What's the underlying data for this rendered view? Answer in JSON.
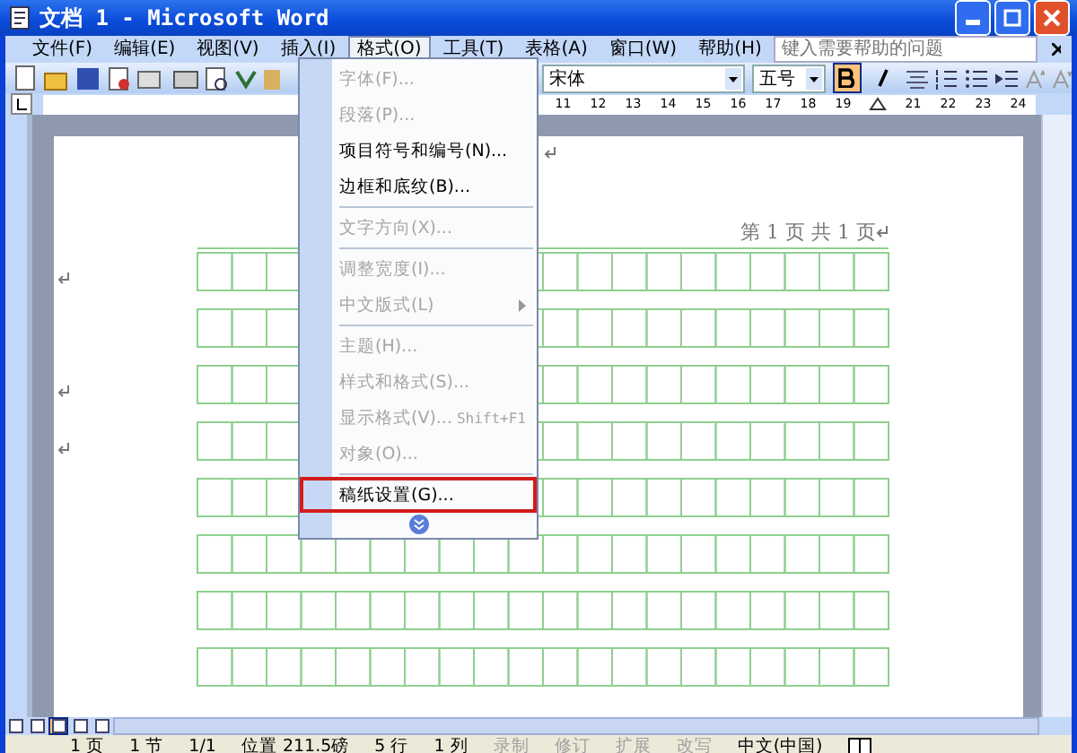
{
  "window": {
    "title": "文档 1 - Microsoft Word"
  },
  "menu_bar": [
    {
      "label": "文件(F)",
      "selected": false
    },
    {
      "label": "编辑(E)",
      "selected": false
    },
    {
      "label": "视图(V)",
      "selected": false
    },
    {
      "label": "插入(I)",
      "selected": false
    },
    {
      "label": "格式(O)",
      "selected": true
    },
    {
      "label": "工具(T)",
      "selected": false
    },
    {
      "label": "表格(A)",
      "selected": false
    },
    {
      "label": "窗口(W)",
      "selected": false
    },
    {
      "label": "帮助(H)",
      "selected": false
    }
  ],
  "help_search": {
    "placeholder": "键入需要帮助的问题"
  },
  "toolbar": {
    "font": "宋体",
    "size": "五号",
    "bold": true,
    "italic": false
  },
  "ruler": {
    "numbers": [
      "11",
      "12",
      "13",
      "14",
      "15",
      "16",
      "17",
      "18",
      "19",
      "21",
      "22",
      "23",
      "24"
    ]
  },
  "document": {
    "header": "第 1 页 共 1 页"
  },
  "format_menu": {
    "groups": [
      [
        {
          "label": "字体(F)...",
          "disabled": true,
          "highlighted": false
        },
        {
          "label": "段落(P)...",
          "disabled": true,
          "highlighted": false
        },
        {
          "label": "项目符号和编号(N)...",
          "disabled": false,
          "highlighted": false
        },
        {
          "label": "边框和底纹(B)...",
          "disabled": false,
          "highlighted": false
        }
      ],
      [
        {
          "label": "文字方向(X)...",
          "disabled": true,
          "highlighted": false
        }
      ],
      [
        {
          "label": "调整宽度(I)...",
          "disabled": true,
          "highlighted": false
        },
        {
          "label": "中文版式(L)",
          "disabled": true,
          "highlighted": false,
          "submenu": true
        }
      ],
      [
        {
          "label": "主题(H)...",
          "disabled": true,
          "highlighted": false
        },
        {
          "label": "样式和格式(S)...",
          "disabled": true,
          "highlighted": false
        },
        {
          "label": "显示格式(V)...",
          "disabled": true,
          "highlighted": false,
          "shortcut": "Shift+F1"
        },
        {
          "label": "对象(O)...",
          "disabled": true,
          "highlighted": false
        }
      ],
      [
        {
          "label": "稿纸设置(G)...",
          "disabled": false,
          "highlighted": true
        }
      ]
    ]
  },
  "view_buttons": [
    {
      "selected": false
    },
    {
      "selected": false
    },
    {
      "selected": true
    },
    {
      "selected": false
    },
    {
      "selected": false
    }
  ],
  "status_bar": [
    {
      "text": "1 页",
      "disabled": false
    },
    {
      "text": "1 节",
      "disabled": false
    },
    {
      "text": "1/1",
      "disabled": false
    },
    {
      "text": "位置 211.5磅",
      "disabled": false
    },
    {
      "text": "5 行",
      "disabled": false
    },
    {
      "text": "1 列",
      "disabled": false
    },
    {
      "text": "录制",
      "disabled": true
    },
    {
      "text": "修订",
      "disabled": true
    },
    {
      "text": "扩展",
      "disabled": true
    },
    {
      "text": "改写",
      "disabled": true
    },
    {
      "text": "中文(中国)",
      "disabled": false
    }
  ]
}
